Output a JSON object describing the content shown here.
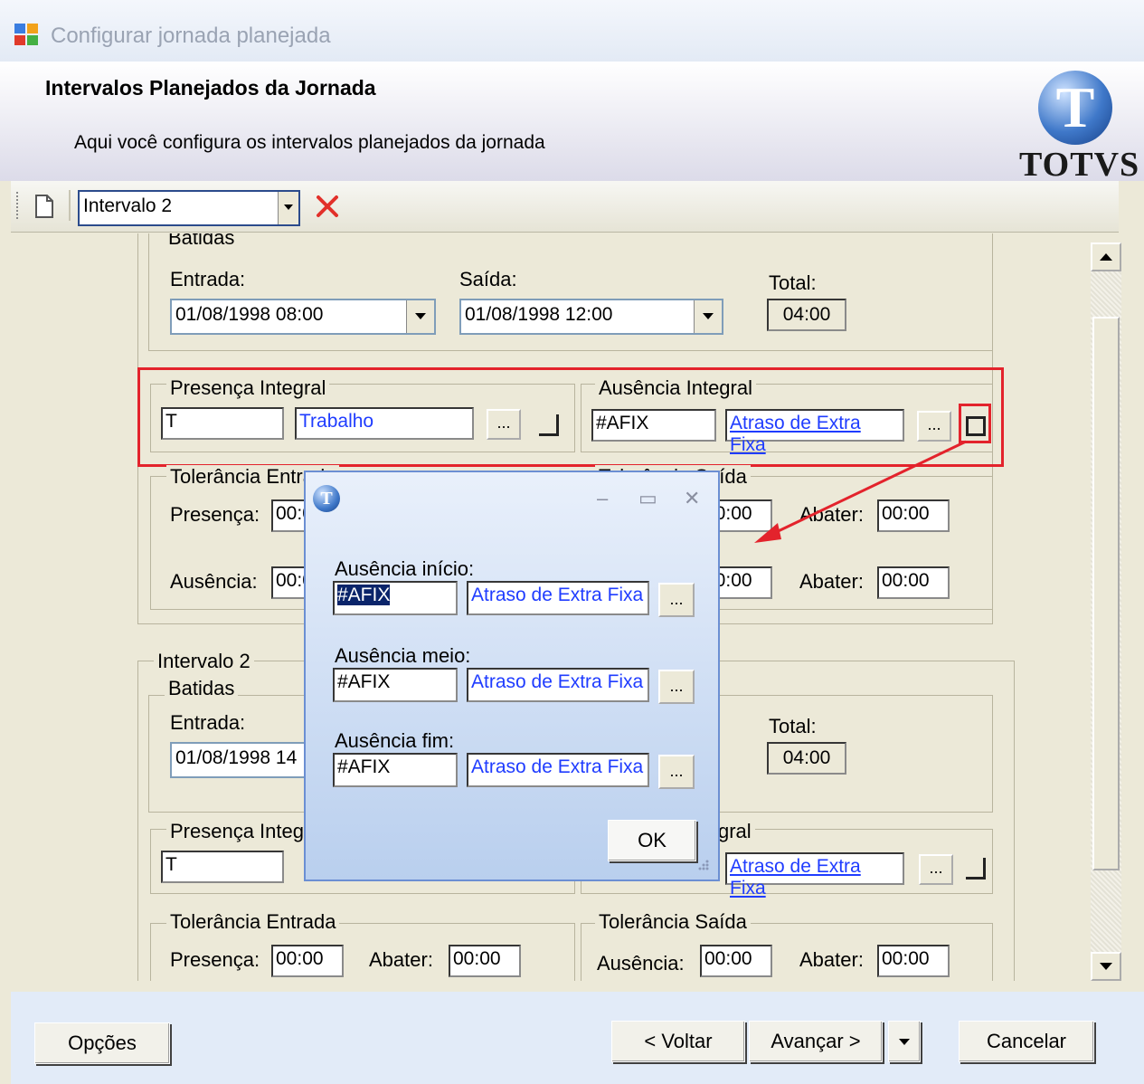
{
  "window": {
    "title": "Configurar jornada planejada"
  },
  "header": {
    "heading": "Intervalos Planejados da Jornada",
    "subtitle": "Aqui você configura os intervalos planejados da jornada",
    "logo_text": "TOTVS"
  },
  "toolbar": {
    "selected_interval": "Intervalo 2"
  },
  "interval1": {
    "batidas_label": "Batidas",
    "entrada_label": "Entrada:",
    "entrada_value": "01/08/1998 08:00",
    "saida_label": "Saída:",
    "saida_value": "01/08/1998 12:00",
    "total_label": "Total:",
    "total_value": "04:00",
    "presenca_integral": {
      "label": "Presença Integral",
      "code": "T",
      "desc": "Trabalho"
    },
    "ausencia_integral": {
      "label": "Ausência Integral",
      "code": "#AFIX",
      "desc": "Atraso de Extra Fixa"
    },
    "tol_entrada": {
      "label": "Tolerância Entrada",
      "presenca_label": "Presença:",
      "presenca_value": "00:00",
      "ausencia_label": "Ausência:",
      "ausencia_value": "00:00"
    },
    "tol_saida": {
      "label": "Tolerância Saída",
      "presenca_value": "00:00",
      "abater1_label": "Abater:",
      "abater1_value": "00:00",
      "ausencia_value": "00:00",
      "abater2_label": "Abater:",
      "abater2_value": "00:00"
    }
  },
  "interval2": {
    "title": "Intervalo 2",
    "batidas_label": "Batidas",
    "entrada_label": "Entrada:",
    "entrada_value": "01/08/1998 14",
    "total_label": "Total:",
    "total_value": "04:00",
    "presenca_integral": {
      "label": "Presença Integ",
      "code": "T"
    },
    "ausencia_integral": {
      "label_partial": "gral",
      "desc": "Atraso de Extra Fixa"
    },
    "tol_entrada": {
      "label": "Tolerância Entrada",
      "presenca_label": "Presença:",
      "presenca_value": "00:00",
      "abater_label": "Abater:",
      "abater_value": "00:00"
    },
    "tol_saida": {
      "label": "Tolerância Saída",
      "ausencia_label": "Ausência:",
      "ausencia_value": "00:00",
      "abater_label": "Abater:",
      "abater_value": "00:00"
    }
  },
  "dialog": {
    "controls": {
      "minimize": "–",
      "maximize": "▭",
      "close": "✕"
    },
    "inicio": {
      "label": "Ausência início:",
      "code": "#AFIX",
      "desc": "Atraso de Extra Fixa"
    },
    "meio": {
      "label": "Ausência meio:",
      "code": "#AFIX",
      "desc": "Atraso de Extra Fixa"
    },
    "fim": {
      "label": "Ausência fim:",
      "code": "#AFIX",
      "desc": "Atraso de Extra Fixa"
    },
    "ok_label": "OK"
  },
  "buttons": {
    "ellipsis": "...",
    "opcoes": "Opções",
    "voltar": "< Voltar",
    "avancar": "Avançar >",
    "cancelar": "Cancelar"
  },
  "colors": {
    "highlight_red": "#e3232c",
    "link_blue": "#1f3cff"
  }
}
